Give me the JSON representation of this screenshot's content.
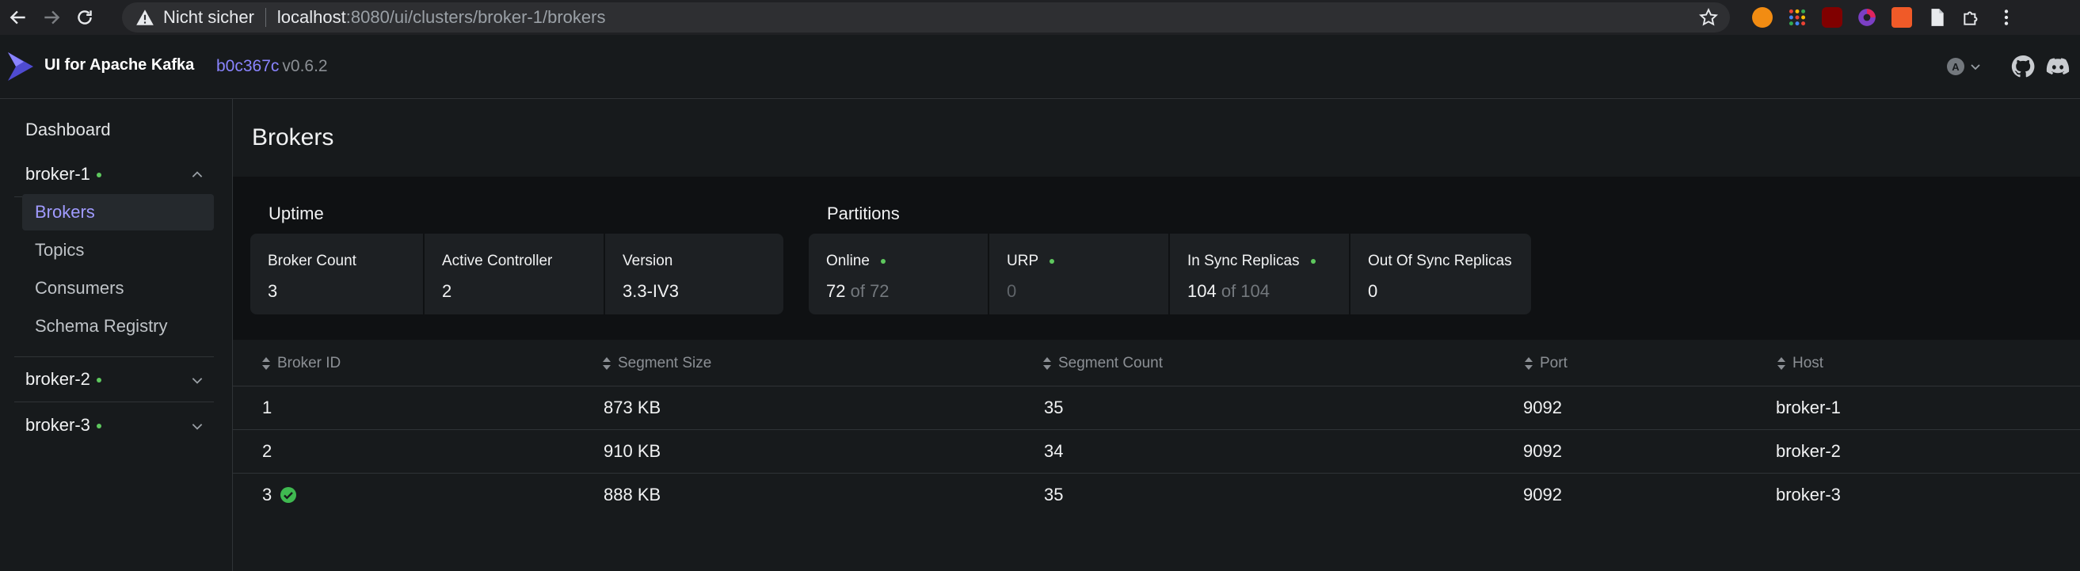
{
  "browser": {
    "security_label": "Nicht sicher",
    "url_host": "localhost",
    "url_path": ":8080/ui/clusters/broker-1/brokers"
  },
  "header": {
    "app_title": "UI for Apache Kafka",
    "commit": "b0c367c",
    "version": "v0.6.2",
    "theme_letter": "A"
  },
  "sidebar": {
    "dashboard_label": "Dashboard",
    "clusters": [
      {
        "name": "broker-1",
        "expanded": true,
        "items": [
          "Brokers",
          "Topics",
          "Consumers",
          "Schema Registry"
        ]
      },
      {
        "name": "broker-2",
        "expanded": false
      },
      {
        "name": "broker-3",
        "expanded": false
      }
    ]
  },
  "page": {
    "title": "Brokers",
    "uptime": {
      "label": "Uptime",
      "cards": [
        {
          "label": "Broker Count",
          "value": "3"
        },
        {
          "label": "Active Controller",
          "value": "2"
        },
        {
          "label": "Version",
          "value": "3.3-IV3"
        }
      ]
    },
    "partitions": {
      "label": "Partitions",
      "cards": [
        {
          "label": "Online",
          "value": "72",
          "of": "of 72"
        },
        {
          "label": "URP",
          "value": "0"
        },
        {
          "label": "In Sync Replicas",
          "value": "104",
          "of": "of 104"
        },
        {
          "label": "Out Of Sync Replicas",
          "value": "0"
        }
      ]
    },
    "table": {
      "columns": [
        "Broker ID",
        "Segment Size",
        "Segment Count",
        "Port",
        "Host"
      ],
      "rows": [
        {
          "id": "1",
          "size": "873 KB",
          "count": "35",
          "port": "9092",
          "host": "broker-1"
        },
        {
          "id": "2",
          "size": "910 KB",
          "count": "34",
          "port": "9092",
          "host": "broker-2"
        },
        {
          "id": "3",
          "size": "888 KB",
          "count": "35",
          "port": "9092",
          "host": "broker-3"
        }
      ]
    }
  },
  "colors": {
    "accent": "#8a84ff",
    "status_green": "#5ec85e",
    "background": "#171a1c"
  }
}
